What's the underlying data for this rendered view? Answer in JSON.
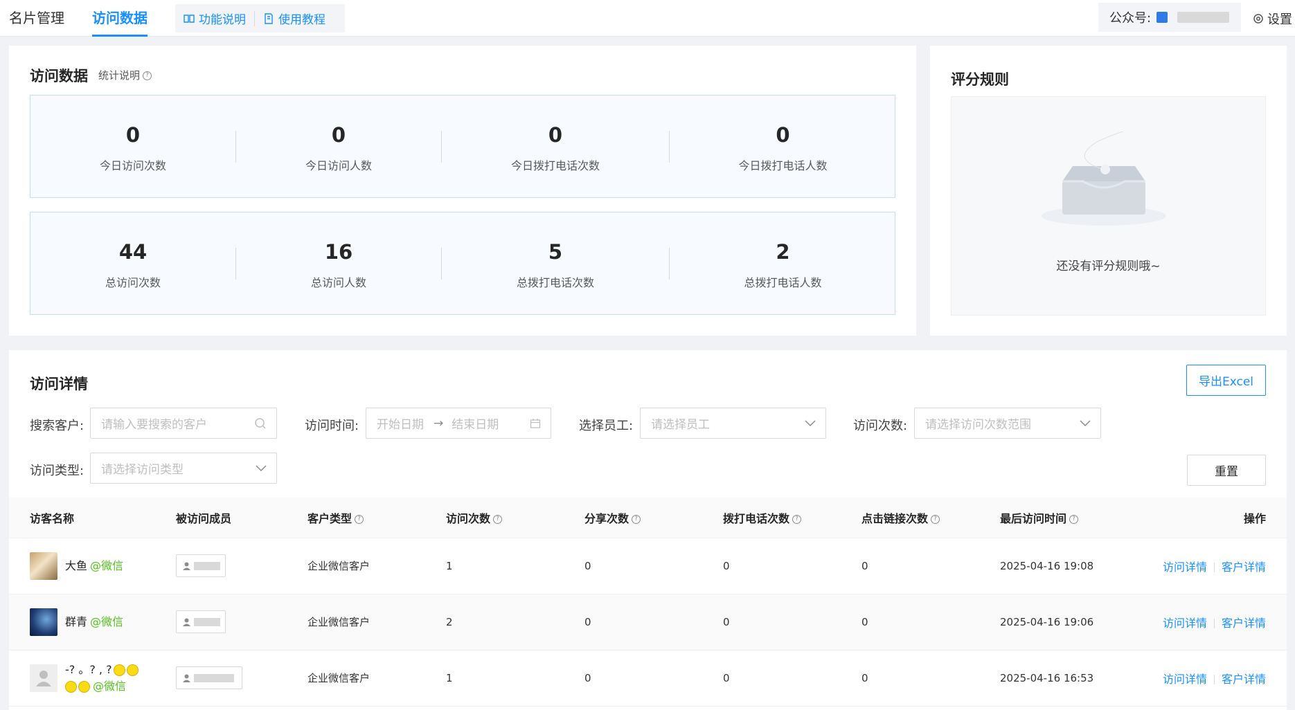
{
  "nav": {
    "tabs": [
      {
        "label": "名片管理",
        "active": false
      },
      {
        "label": "访问数据",
        "active": true
      }
    ],
    "help_links": [
      "功能说明",
      "使用教程"
    ],
    "official_account_label": "公众号:",
    "settings_label": "设置"
  },
  "stats_card": {
    "title": "访问数据",
    "note": "统计说明",
    "today": [
      {
        "value": "0",
        "label": "今日访问次数"
      },
      {
        "value": "0",
        "label": "今日访问人数"
      },
      {
        "value": "0",
        "label": "今日拨打电话次数"
      },
      {
        "value": "0",
        "label": "今日拨打电话人数"
      }
    ],
    "total": [
      {
        "value": "44",
        "label": "总访问次数"
      },
      {
        "value": "16",
        "label": "总访问人数"
      },
      {
        "value": "5",
        "label": "总拨打电话次数"
      },
      {
        "value": "2",
        "label": "总拨打电话人数"
      }
    ]
  },
  "rules_card": {
    "title": "评分规则",
    "empty_text": "还没有评分规则哦~"
  },
  "detail": {
    "title": "访问详情",
    "export_label": "导出Excel",
    "reset_label": "重置",
    "filters": {
      "customer_label": "搜索客户:",
      "customer_placeholder": "请输入要搜索的客户",
      "time_label": "访问时间:",
      "start_placeholder": "开始日期",
      "end_placeholder": "结束日期",
      "staff_label": "选择员工:",
      "staff_placeholder": "请选择员工",
      "count_label": "访问次数:",
      "count_placeholder": "请选择访问次数范围",
      "type_label": "访问类型:",
      "type_placeholder": "请选择访问类型"
    },
    "columns": [
      "访客名称",
      "被访问成员",
      "客户类型",
      "访问次数",
      "分享次数",
      "拨打电话次数",
      "点击链接次数",
      "最后访问时间",
      "操作"
    ],
    "rows": [
      {
        "name": "大鱼",
        "source": "@微信",
        "type": "企业微信客户",
        "visits": "1",
        "shares": "0",
        "calls": "0",
        "clicks": "0",
        "last_visit": "2025-04-16 19:08"
      },
      {
        "name": "群青",
        "source": "@微信",
        "type": "企业微信客户",
        "visits": "2",
        "shares": "0",
        "calls": "0",
        "clicks": "0",
        "last_visit": "2025-04-16 19:06"
      },
      {
        "name": "-? 。? , ?",
        "source": "@微信",
        "type": "企业微信客户",
        "visits": "1",
        "shares": "0",
        "calls": "0",
        "clicks": "0",
        "last_visit": "2025-04-16 16:53"
      }
    ],
    "actions": [
      "访问详情",
      "客户详情"
    ]
  },
  "colors": {
    "accent": "#1890ff",
    "wechat": "#52c41a",
    "stat_border": "#bfdffb"
  }
}
